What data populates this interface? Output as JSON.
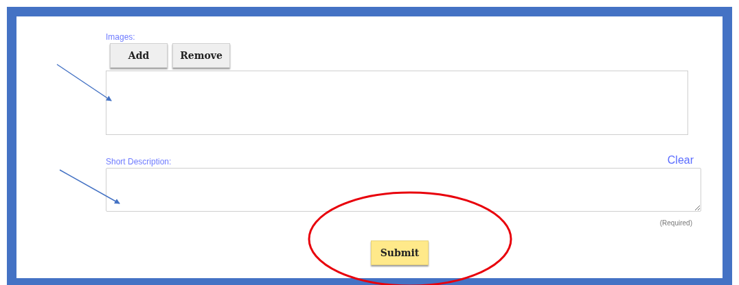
{
  "images": {
    "label": "Images:",
    "buttons": [
      "Add",
      "Remove"
    ]
  },
  "short_description": {
    "label": "Short Description:",
    "clear": "Clear",
    "note": "(Required)"
  },
  "submit": "Submit"
}
